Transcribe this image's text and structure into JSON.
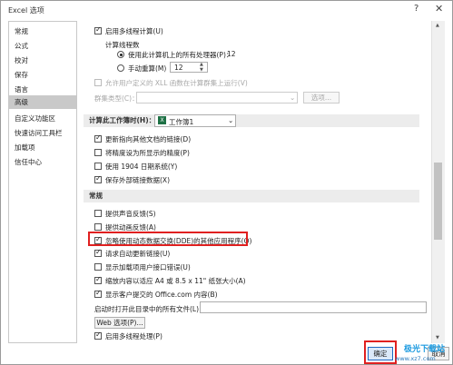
{
  "window": {
    "title": "Excel 选项",
    "help": "?",
    "close": "✕"
  },
  "nav": {
    "items": [
      "常规",
      "公式",
      "校对",
      "保存",
      "语言",
      "高级",
      "自定义功能区",
      "快速访问工具栏",
      "加载项",
      "信任中心"
    ],
    "selected": 5
  },
  "multithread": {
    "enable": "启用多线程计算(U)",
    "threads_title": "计算线程数",
    "all_processors": "使用此计算机上的所有处理器(P)：",
    "processor_count": "12",
    "manual": "手动重算(M)",
    "manual_value": "12",
    "xll": "允许用户定义的 XLL 函数在计算群集上运行(V)",
    "cluster_type_label": "群集类型(C)：",
    "options_button": "选项..."
  },
  "workbook_section": {
    "title": "计算此工作簿时(H)：",
    "workbook": "工作簿1",
    "items": [
      {
        "label": "更新指向其他文档的链接(D)",
        "checked": true
      },
      {
        "label": "将精度设为所显示的精度(P)",
        "checked": false
      },
      {
        "label": "使用 1904 日期系统(Y)",
        "checked": false
      },
      {
        "label": "保存外部链接数据(X)",
        "checked": true
      }
    ]
  },
  "general_section": {
    "title": "常规",
    "items": [
      {
        "label": "提供声音反馈(S)",
        "checked": false
      },
      {
        "label": "提供动画反馈(A)",
        "checked": false
      },
      {
        "label": "忽略使用动态数据交换(DDE)的其他应用程序(O)",
        "checked": true
      },
      {
        "label": "请求自动更新链接(U)",
        "checked": true
      },
      {
        "label": "显示加载项用户接口错误(U)",
        "checked": false
      },
      {
        "label": "缩放内容以适应 A4 或 8.5 x 11\" 纸张大小(A)",
        "checked": true
      },
      {
        "label": "显示客户提交的 Office.com 内容(B)",
        "checked": true
      }
    ],
    "startup_label": "启动时打开此目录中的所有文件(L)：",
    "web_button": "Web 选项(P)...",
    "multithread_label": "启用多线程处理(P)"
  },
  "footer": {
    "ok": "确定",
    "cancel": "取消"
  },
  "watermark": {
    "brand": "极光下载站",
    "url": "www.xz7.com"
  }
}
